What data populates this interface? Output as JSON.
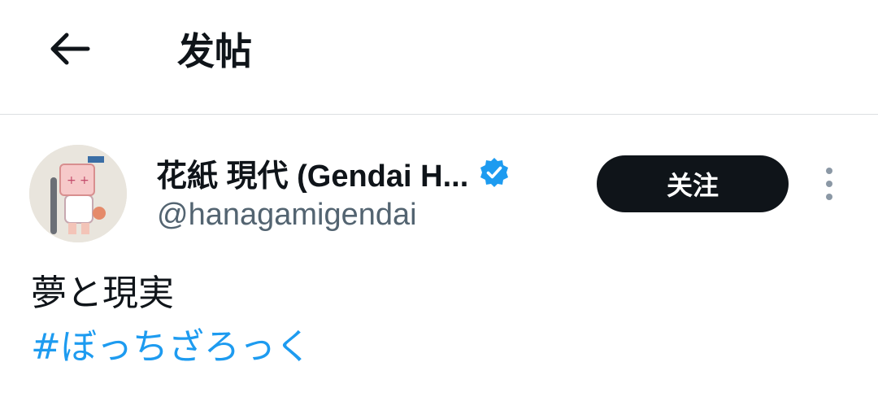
{
  "header": {
    "title": "发帖",
    "back_icon": "arrow-left-icon"
  },
  "author": {
    "display_name": "花紙 現代 (Gendai H...",
    "handle": "@hanagamigendai",
    "verified_icon": "verified-badge-icon",
    "verified_color": "#1d9bf0"
  },
  "actions": {
    "follow_label": "关注",
    "more_icon": "more-vertical-icon"
  },
  "post": {
    "text": "夢と現実",
    "hashtag": "#ぼっちざろっく"
  },
  "colors": {
    "accent": "#1d9bf0",
    "text_primary": "#0f1419",
    "text_secondary": "#536471",
    "button_bg": "#0f1419"
  }
}
